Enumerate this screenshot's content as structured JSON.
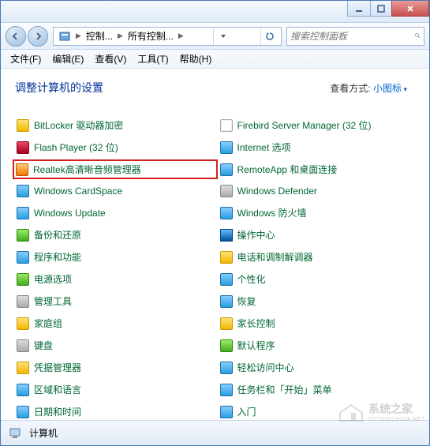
{
  "titlebar": {
    "min": "minimize",
    "max": "maximize",
    "close": "close"
  },
  "nav": {
    "segments": [
      "控制...",
      "所有控制..."
    ],
    "search_placeholder": "搜索控制面板"
  },
  "menus": [
    "文件(F)",
    "编辑(E)",
    "查看(V)",
    "工具(T)",
    "帮助(H)"
  ],
  "heading": "调整计算机的设置",
  "viewby_label": "查看方式:",
  "viewby_value": "小图标",
  "items_left": [
    {
      "label": "BitLocker 驱动器加密",
      "icon": "ic-yellow",
      "name": "bitlocker"
    },
    {
      "label": "Flash Player (32 位)",
      "icon": "ic-red",
      "name": "flash-player"
    },
    {
      "label": "Realtek高清晰音频管理器",
      "icon": "ic-orange",
      "name": "realtek-audio",
      "highlight": true
    },
    {
      "label": "Windows CardSpace",
      "icon": "ic-blue",
      "name": "windows-cardspace"
    },
    {
      "label": "Windows Update",
      "icon": "ic-blue",
      "name": "windows-update"
    },
    {
      "label": "备份和还原",
      "icon": "ic-green",
      "name": "backup-restore"
    },
    {
      "label": "程序和功能",
      "icon": "ic-blue",
      "name": "programs-features"
    },
    {
      "label": "电源选项",
      "icon": "ic-green",
      "name": "power-options"
    },
    {
      "label": "管理工具",
      "icon": "ic-gray",
      "name": "admin-tools"
    },
    {
      "label": "家庭组",
      "icon": "ic-yellow",
      "name": "homegroup"
    },
    {
      "label": "键盘",
      "icon": "ic-gray",
      "name": "keyboard"
    },
    {
      "label": "凭据管理器",
      "icon": "ic-yellow",
      "name": "credential-manager"
    },
    {
      "label": "区域和语言",
      "icon": "ic-blue",
      "name": "region-language"
    },
    {
      "label": "日期和时间",
      "icon": "ic-blue",
      "name": "date-time"
    }
  ],
  "items_right": [
    {
      "label": "Firebird Server Manager (32 位)",
      "icon": "ic-page",
      "name": "firebird-server"
    },
    {
      "label": "Internet 选项",
      "icon": "ic-blue",
      "name": "internet-options"
    },
    {
      "label": "RemoteApp 和桌面连接",
      "icon": "ic-blue",
      "name": "remoteapp"
    },
    {
      "label": "Windows Defender",
      "icon": "ic-gray",
      "name": "windows-defender"
    },
    {
      "label": "Windows 防火墙",
      "icon": "ic-blue",
      "name": "windows-firewall"
    },
    {
      "label": "操作中心",
      "icon": "ic-flag",
      "name": "action-center"
    },
    {
      "label": "电话和调制解调器",
      "icon": "ic-yellow",
      "name": "phone-modem"
    },
    {
      "label": "个性化",
      "icon": "ic-blue",
      "name": "personalization"
    },
    {
      "label": "恢复",
      "icon": "ic-blue",
      "name": "recovery"
    },
    {
      "label": "家长控制",
      "icon": "ic-yellow",
      "name": "parental-controls"
    },
    {
      "label": "默认程序",
      "icon": "ic-green",
      "name": "default-programs"
    },
    {
      "label": "轻松访问中心",
      "icon": "ic-blue",
      "name": "ease-of-access"
    },
    {
      "label": "任务栏和「开始」菜单",
      "icon": "ic-blue",
      "name": "taskbar-start"
    },
    {
      "label": "入门",
      "icon": "ic-blue",
      "name": "getting-started"
    }
  ],
  "status": "计算机",
  "watermark": "系统之家",
  "watermark_sub": "XITONGZHIJIA.NET"
}
